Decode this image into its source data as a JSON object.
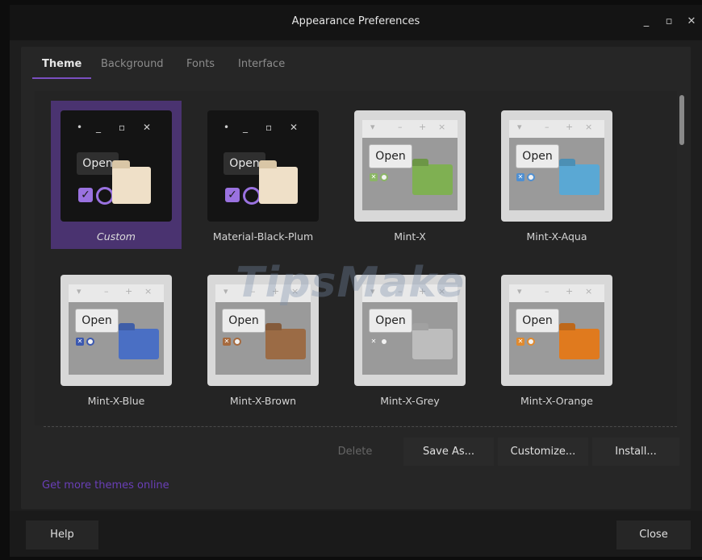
{
  "window": {
    "title": "Appearance Preferences",
    "controls": [
      "_",
      "▫",
      "✕"
    ]
  },
  "tabs": [
    "Theme",
    "Background",
    "Fonts",
    "Interface"
  ],
  "themes": [
    {
      "name": "Custom",
      "style": "dark",
      "folder": "#efe0c8",
      "selected": true
    },
    {
      "name": "Material-Black-Plum",
      "style": "dark",
      "folder": "#efe0c8",
      "selected": false
    },
    {
      "name": "Mint-X",
      "style": "light",
      "folder": "#7fb052",
      "accent": "#8bb665",
      "selected": false
    },
    {
      "name": "Mint-X-Aqua",
      "style": "light",
      "folder": "#5aa8d4",
      "accent": "#4f8fd1",
      "selected": false
    },
    {
      "name": "Mint-X-Blue",
      "style": "light",
      "folder": "#4a6fc4",
      "accent": "#3b58b0",
      "selected": false
    },
    {
      "name": "Mint-X-Brown",
      "style": "light",
      "folder": "#9b6b45",
      "accent": "#a66a3e",
      "selected": false
    },
    {
      "name": "Mint-X-Grey",
      "style": "light",
      "folder": "#bdbdbd",
      "accent": "#9a9a9a",
      "selected": false
    },
    {
      "name": "Mint-X-Orange",
      "style": "light",
      "folder": "#e07a1e",
      "accent": "#e08a2f",
      "selected": false
    }
  ],
  "thumb_text": {
    "open": "Open",
    "dark_controls": [
      "•",
      "_",
      "▫",
      "✕"
    ],
    "light_controls": [
      "▾",
      "–",
      "+",
      "×"
    ]
  },
  "actions": {
    "delete": "Delete",
    "save_as": "Save As...",
    "customize": "Customize...",
    "install": "Install..."
  },
  "link": "Get more themes online",
  "footer": {
    "help": "Help",
    "close": "Close"
  },
  "watermark": "TipsMake",
  "colors": {
    "accent": "#7a4fc0",
    "selected_bg": "#4a3370",
    "link": "#6a3fb8"
  }
}
